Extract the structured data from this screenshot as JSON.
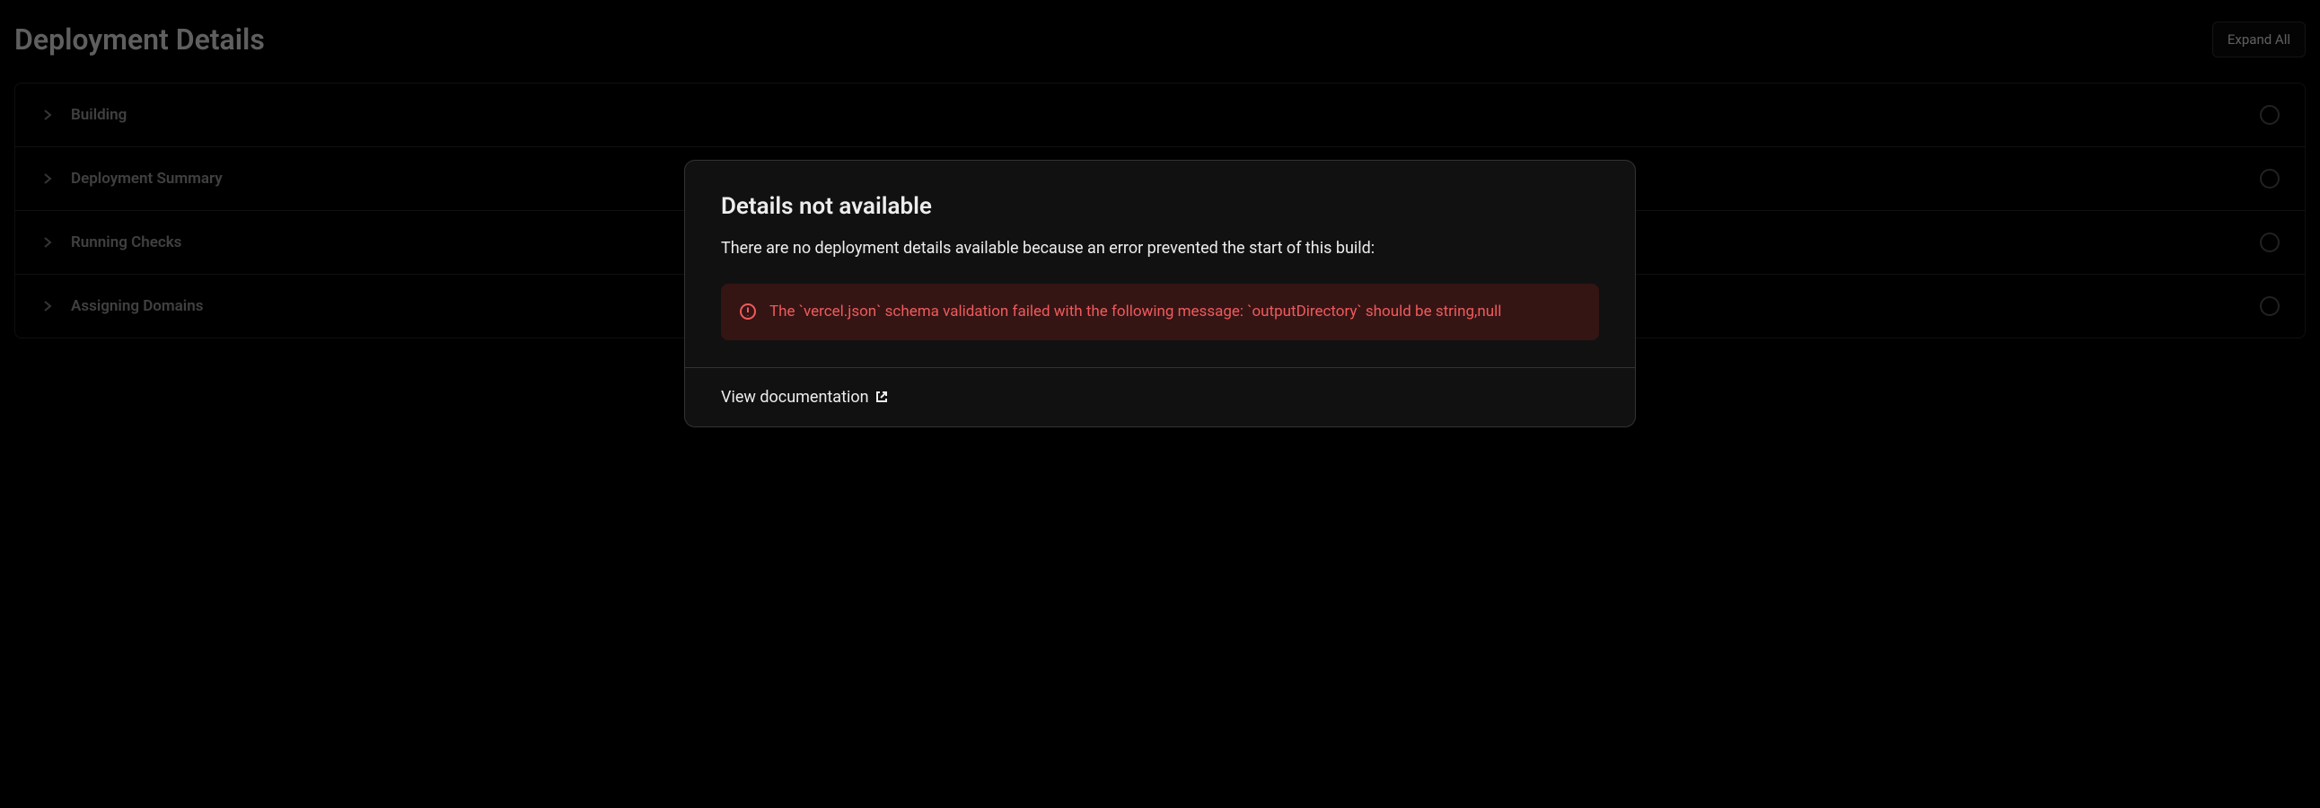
{
  "header": {
    "title": "Deployment Details",
    "expandAllLabel": "Expand All"
  },
  "accordion": {
    "items": [
      {
        "label": "Building"
      },
      {
        "label": "Deployment Summary"
      },
      {
        "label": "Running Checks"
      },
      {
        "label": "Assigning Domains"
      }
    ]
  },
  "modal": {
    "title": "Details not available",
    "description": "There are no deployment details available because an error prevented the start of this build:",
    "errorMessage": "The `vercel.json` schema validation failed with the following message: `outputDirectory` should be string,null",
    "docLinkLabel": "View documentation"
  }
}
